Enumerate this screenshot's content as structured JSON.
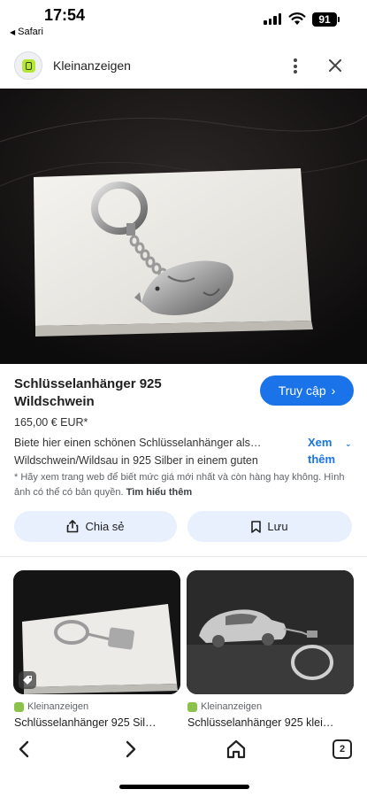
{
  "status_bar": {
    "time": "17:54",
    "back_app": "Safari",
    "battery": "91"
  },
  "header": {
    "site_name": "Kleinanzeigen",
    "logo_icon": "kleinanzeigen-leaf-logo",
    "menu_icon": "more-vert-icon",
    "close_icon": "close-icon"
  },
  "listing": {
    "title": "Schlüsselanhänger 925 Wildschwein",
    "visit_label": "Truy cập",
    "price": "165,00 € EUR*",
    "description_line1": "Biete hier einen schönen Schlüsselanhänger als…",
    "description_line2": "Wildschwein/Wildsau in 925 Silber in einem guten",
    "see_more": "Xem thêm",
    "notice": "* Hãy xem trang web để biết mức giá mới nhất và còn hàng hay không. Hình ảnh có thể có bản quyền.",
    "learn_more": "Tìm hiểu thêm",
    "share_label": "Chia sẻ",
    "save_label": "Lưu"
  },
  "related": [
    {
      "source": "Kleinanzeigen",
      "title": "Schlüsselanhänger 925 Sil…"
    },
    {
      "source": "Kleinanzeigen",
      "title": "Schlüsselanhänger 925 klei…"
    }
  ],
  "bottom_nav": {
    "tab_count": "2"
  },
  "colors": {
    "accent": "#1a73e8",
    "pill_bg": "#e8f0fe",
    "logo_green": "#b5e634"
  }
}
